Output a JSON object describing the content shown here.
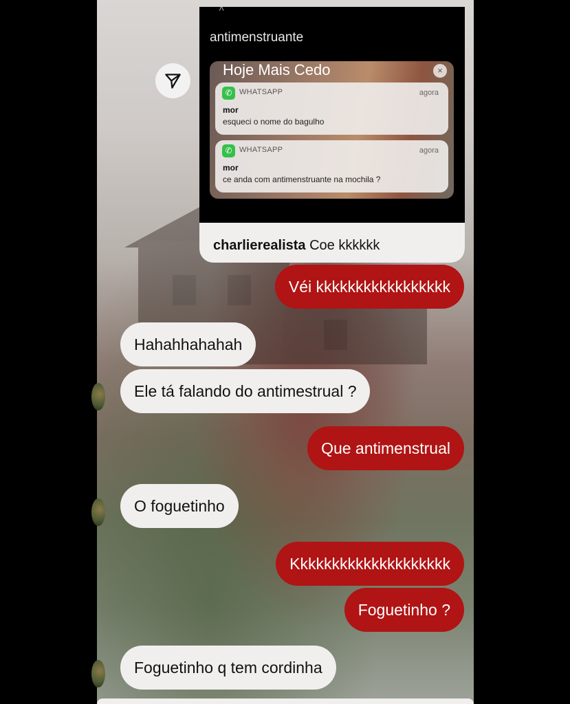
{
  "story": {
    "title": "antimenstruante",
    "reply_user": "charlierealista",
    "reply_text": "Coe kkkkkk",
    "notifications_header": "Hoje Mais Cedo",
    "close_glyph": "×",
    "notifications": [
      {
        "app": "WHATSAPP",
        "time": "agora",
        "sender": "mor",
        "message": "esqueci o nome do bagulho"
      },
      {
        "app": "WHATSAPP",
        "time": "agora",
        "sender": "mor",
        "message": "ce anda com antimenstruante na mochila ?"
      }
    ]
  },
  "messages": [
    {
      "side": "out",
      "text": "Véi kkkkkkkkkkkkkkkkk"
    },
    {
      "side": "in",
      "text": "Hahahhahahah"
    },
    {
      "side": "in",
      "text": "Ele tá falando do antimestrual ?"
    },
    {
      "side": "out",
      "text": "Que antimenstrual"
    },
    {
      "side": "in",
      "text": "O foguetinho"
    },
    {
      "side": "out",
      "text": "Kkkkkkkkkkkkkkkkkkkk"
    },
    {
      "side": "out",
      "text": "Foguetinho ?"
    },
    {
      "side": "in",
      "text": "Foguetinho q tem cordinha"
    }
  ],
  "colors": {
    "outgoing_bubble": "#b01414",
    "incoming_bubble": "#f1efee"
  },
  "icons": {
    "share": "paper-plane-icon",
    "app": "whatsapp-icon"
  }
}
